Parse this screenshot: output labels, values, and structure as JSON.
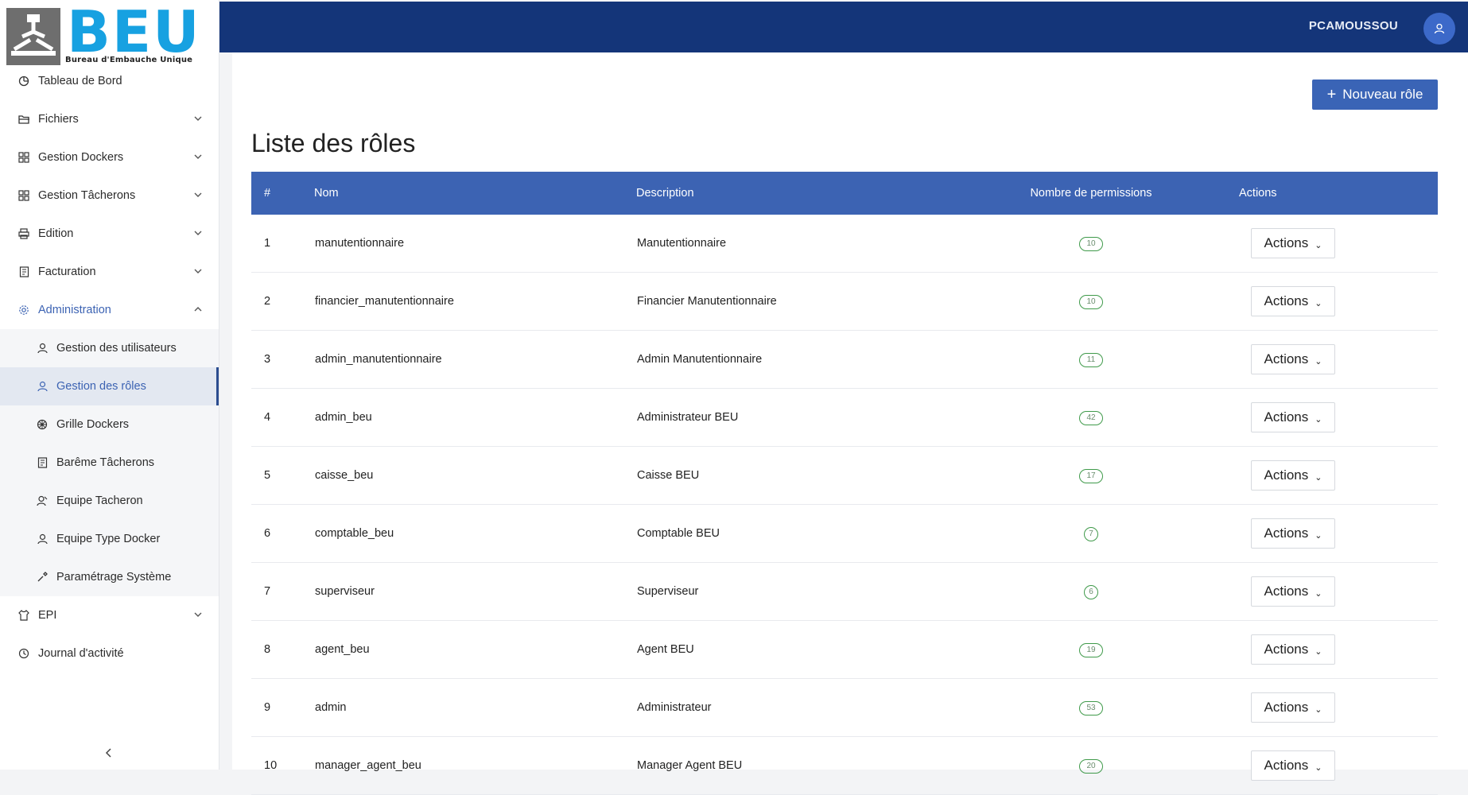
{
  "logo": {
    "letters": "BEU",
    "tagline": "Bureau d'Embauche Unique"
  },
  "sidebar": {
    "items": [
      {
        "label": "Tableau de Bord",
        "icon": "dashboard-icon"
      },
      {
        "label": "Fichiers",
        "icon": "folder-icon"
      },
      {
        "label": "Gestion Dockers",
        "icon": "grid-icon"
      },
      {
        "label": "Gestion Tâcherons",
        "icon": "grid-icon"
      },
      {
        "label": "Edition",
        "icon": "printer-icon"
      },
      {
        "label": "Facturation",
        "icon": "invoice-icon"
      },
      {
        "label": "Administration",
        "icon": "gear-icon"
      },
      {
        "label": "EPI",
        "icon": "shirt-icon"
      },
      {
        "label": "Journal d'activité",
        "icon": "history-icon"
      }
    ],
    "admin_sub": [
      {
        "label": "Gestion des utilisateurs",
        "icon": "user-icon"
      },
      {
        "label": "Gestion des rôles",
        "icon": "user-icon"
      },
      {
        "label": "Grille Dockers",
        "icon": "wheel-icon"
      },
      {
        "label": "Barême Tâcherons",
        "icon": "invoice-icon"
      },
      {
        "label": "Equipe Tacheron",
        "icon": "team-icon"
      },
      {
        "label": "Equipe Type Docker",
        "icon": "user-icon"
      },
      {
        "label": "Paramétrage Système",
        "icon": "tools-icon"
      }
    ]
  },
  "header": {
    "username": "PCAMOUSSOU"
  },
  "main": {
    "new_role_label": "Nouveau rôle",
    "title": "Liste des rôles",
    "columns": [
      "#",
      "Nom",
      "Description",
      "Nombre de permissions",
      "Actions"
    ],
    "action_label": "Actions",
    "rows": [
      {
        "num": "1",
        "nom": "manutentionnaire",
        "desc": "Manutentionnaire",
        "perms": "10"
      },
      {
        "num": "2",
        "nom": "financier_manutentionnaire",
        "desc": "Financier Manutentionnaire",
        "perms": "10"
      },
      {
        "num": "3",
        "nom": "admin_manutentionnaire",
        "desc": "Admin Manutentionnaire",
        "perms": "11"
      },
      {
        "num": "4",
        "nom": "admin_beu",
        "desc": "Administrateur BEU",
        "perms": "42"
      },
      {
        "num": "5",
        "nom": "caisse_beu",
        "desc": "Caisse BEU",
        "perms": "17"
      },
      {
        "num": "6",
        "nom": "comptable_beu",
        "desc": "Comptable BEU",
        "perms": "7"
      },
      {
        "num": "7",
        "nom": "superviseur",
        "desc": "Superviseur",
        "perms": "6"
      },
      {
        "num": "8",
        "nom": "agent_beu",
        "desc": "Agent BEU",
        "perms": "19"
      },
      {
        "num": "9",
        "nom": "admin",
        "desc": "Administrateur",
        "perms": "53"
      },
      {
        "num": "10",
        "nom": "manager_agent_beu",
        "desc": "Manager Agent BEU",
        "perms": "20"
      }
    ]
  },
  "colors": {
    "topbar": "#143579",
    "accent": "#3c63b3",
    "badge": "#3f9a4a",
    "logo": "#17a1e1"
  }
}
